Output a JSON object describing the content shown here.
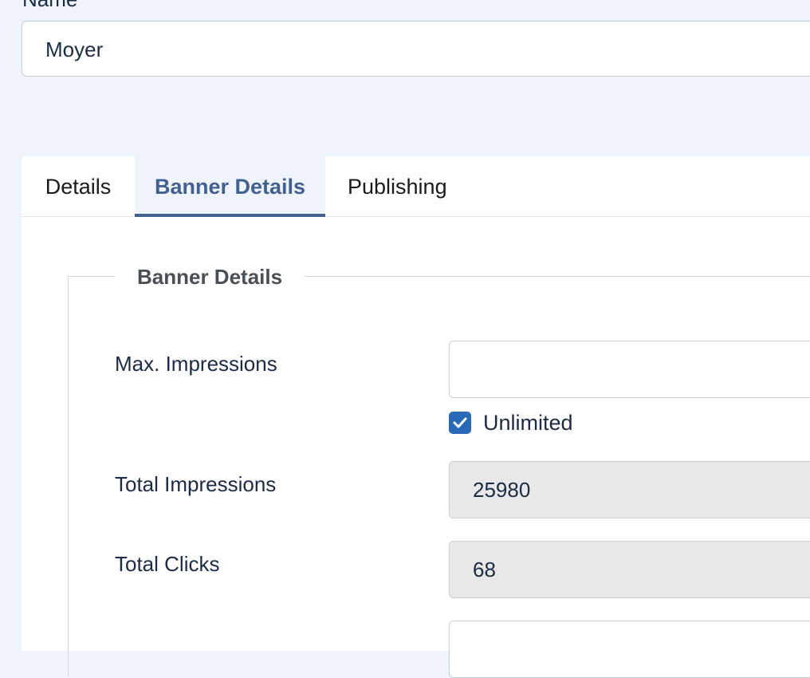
{
  "name_field": {
    "label": "Name",
    "value": "Moyer"
  },
  "tabs": [
    {
      "label": "Details",
      "active": false
    },
    {
      "label": "Banner Details",
      "active": true
    },
    {
      "label": "Publishing",
      "active": false
    }
  ],
  "banner_details": {
    "legend": "Banner Details",
    "max_impressions": {
      "label": "Max. Impressions",
      "value": "",
      "unlimited_label": "Unlimited",
      "unlimited_checked": true
    },
    "total_impressions": {
      "label": "Total Impressions",
      "value": "25980"
    },
    "total_clicks": {
      "label": "Total Clicks",
      "value": "68"
    }
  },
  "colors": {
    "accent": "#43618f",
    "checkbox": "#2a69b8",
    "page_background": "#eff4fb",
    "readonly_background": "#e8e8e8"
  }
}
